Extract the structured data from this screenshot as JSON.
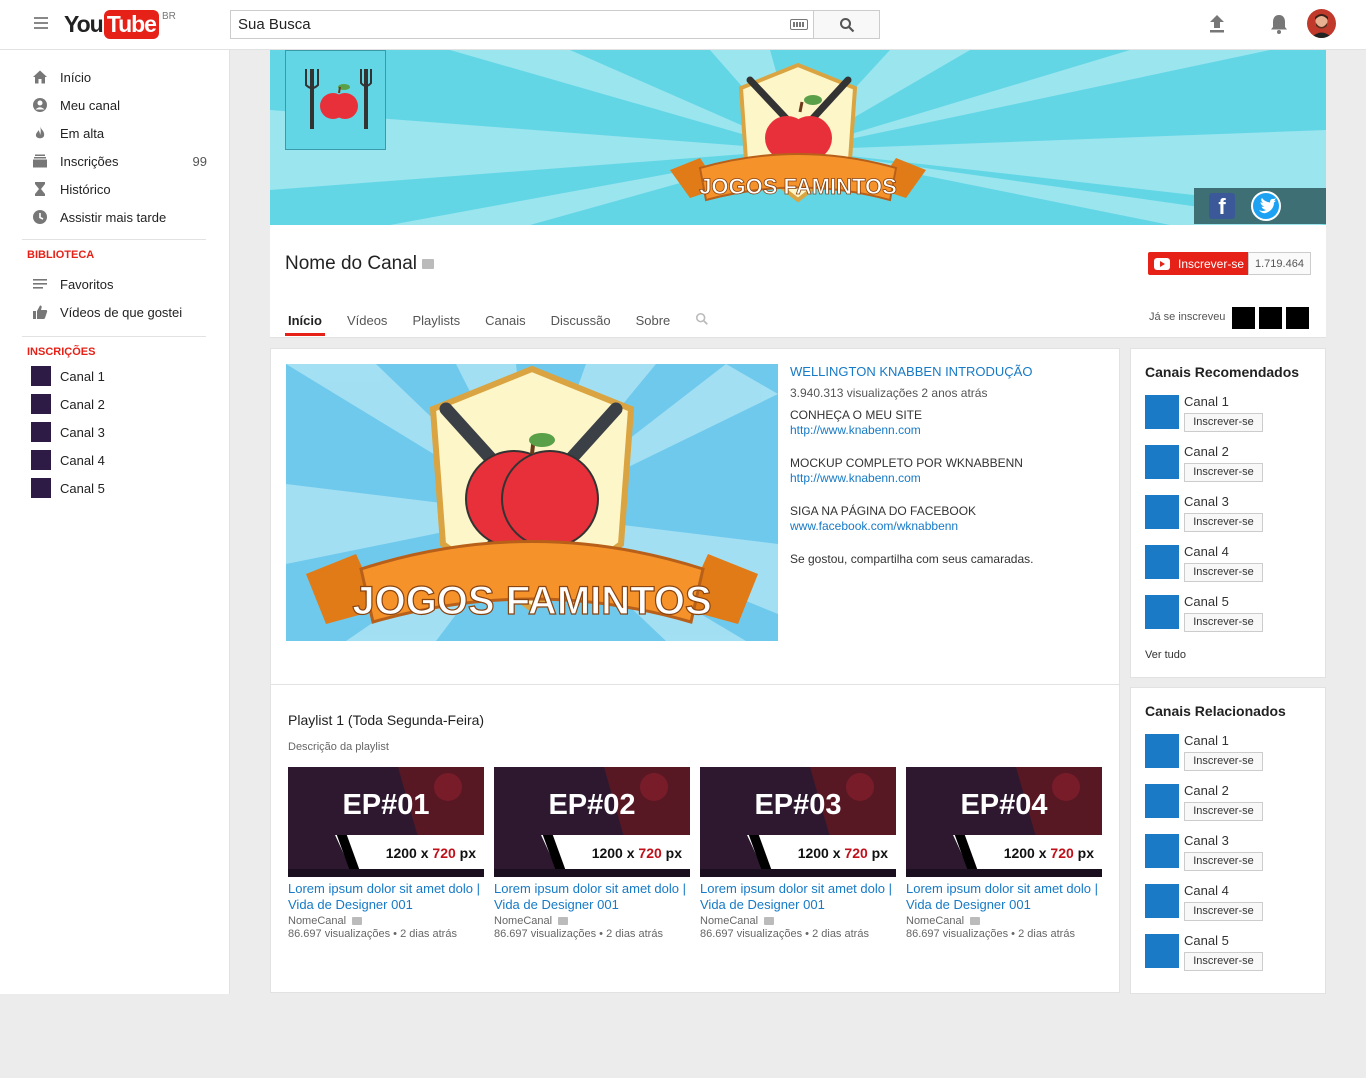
{
  "header": {
    "logo_you": "You",
    "logo_tube": "Tube",
    "logo_country": "BR",
    "search_value": "Sua Busca",
    "icons": [
      "menu-icon",
      "keyboard-icon",
      "search-icon",
      "upload-icon",
      "bell-icon",
      "avatar"
    ]
  },
  "sidebar": {
    "items": [
      {
        "label": "Início",
        "icon": "home-icon"
      },
      {
        "label": "Meu canal",
        "icon": "account-icon"
      },
      {
        "label": "Em alta",
        "icon": "flame-icon"
      },
      {
        "label": "Inscrições",
        "icon": "subscriptions-icon",
        "count": "99"
      },
      {
        "label": "Histórico",
        "icon": "hourglass-icon"
      },
      {
        "label": "Assistir mais tarde",
        "icon": "clock-icon"
      }
    ],
    "library_title": "BIBLIOTECA",
    "library": [
      {
        "label": "Favoritos",
        "icon": "list-icon"
      },
      {
        "label": "Vídeos de que gostei",
        "icon": "thumbs-up-icon"
      }
    ],
    "subs_title": "INSCRIÇÕES",
    "subs": [
      "Canal 1",
      "Canal 2",
      "Canal 3",
      "Canal 4",
      "Canal 5"
    ]
  },
  "banner": {
    "brand": "JOGOS FAMINTOS",
    "social": [
      "f"
    ]
  },
  "channel": {
    "name": "Nome do Canal",
    "subscribe_label": "Inscrever-se",
    "subscriber_count": "1.719.464",
    "tabs": [
      "Início",
      "Vídeos",
      "Playlists",
      "Canais",
      "Discussão",
      "Sobre"
    ],
    "already_subscribed": "Já se inscreveu"
  },
  "featured": {
    "title": "WELLINGTON KNABBEN INTRODUÇÃO",
    "meta": "3.940.313 visualizações 2 anos atrás",
    "desc": [
      {
        "text": "CONHEÇA O MEU SITE",
        "link": "http://www.knabenn.com"
      },
      {
        "text": "MOCKUP COMPLETO POR WKNABBENN",
        "link": "http://www.knabenn.com"
      },
      {
        "text": "SIGA NA PÁGINA DO FACEBOOK",
        "link": "www.facebook.com/wknabbenn"
      }
    ],
    "closing": "Se gostou, compartilha com seus camaradas."
  },
  "playlist": {
    "title": "Playlist 1 (Toda Segunda-Feira)",
    "description": "Descrição da playlist",
    "videos": [
      {
        "ep": "EP#01",
        "res_a": "1200 x ",
        "res_b": "720",
        "res_c": " px",
        "title": "Lorem ipsum dolor sit amet dolo | Vida de Designer 001",
        "channel": "NomeCanal",
        "meta": "86.697 visualizações • 2 dias atrás"
      },
      {
        "ep": "EP#02",
        "res_a": "1200 x ",
        "res_b": "720",
        "res_c": " px",
        "title": "Lorem ipsum dolor sit amet dolo | Vida de Designer 001",
        "channel": "NomeCanal",
        "meta": "86.697 visualizações • 2 dias atrás"
      },
      {
        "ep": "EP#03",
        "res_a": "1200 x ",
        "res_b": "720",
        "res_c": " px",
        "title": "Lorem ipsum dolor sit amet dolo | Vida de Designer 001",
        "channel": "NomeCanal",
        "meta": "86.697 visualizações • 2 dias atrás"
      },
      {
        "ep": "EP#04",
        "res_a": "1200 x ",
        "res_b": "720",
        "res_c": " px",
        "title": "Lorem ipsum dolor sit amet dolo | Vida de Designer 001",
        "channel": "NomeCanal",
        "meta": "86.697 visualizações • 2 dias atrás"
      }
    ]
  },
  "recommended": {
    "title": "Canais Recomendados",
    "channels": [
      "Canal 1",
      "Canal 2",
      "Canal 3",
      "Canal 4",
      "Canal 5"
    ],
    "button": "Inscrever-se",
    "see_all": "Ver tudo"
  },
  "related": {
    "title": "Canais Relacionados",
    "channels": [
      "Canal 1",
      "Canal 2",
      "Canal 3",
      "Canal 4",
      "Canal 5"
    ],
    "button": "Inscrever-se"
  },
  "colors": {
    "accent": "#e62117",
    "link": "#167ac6",
    "banner_bg": "#63d6e6",
    "channel_square": "#1a7ac6",
    "sub_square": "#2d1b46"
  }
}
